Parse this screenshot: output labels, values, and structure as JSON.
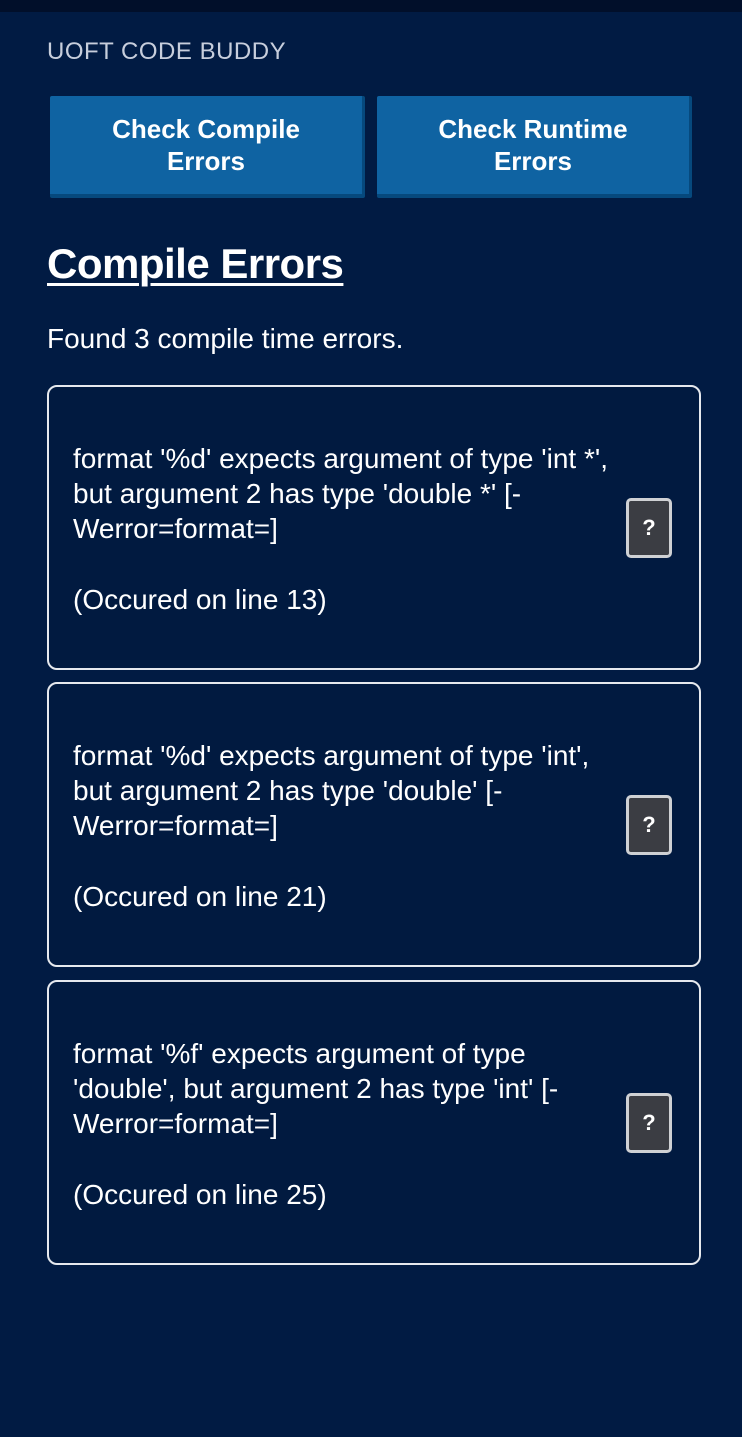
{
  "app": {
    "title": "UOFT CODE BUDDY"
  },
  "actions": {
    "compile_label": "Check Compile Errors",
    "runtime_label": "Check Runtime Errors"
  },
  "section": {
    "title": "Compile Errors",
    "summary": "Found 3 compile time errors."
  },
  "errors": [
    {
      "message": "format '%d' expects argument of type 'int *', but argument 2 has type 'double *' [-Werror=format=]",
      "line_text": "(Occured on line 13)",
      "help_label": "?"
    },
    {
      "message": "format '%d' expects argument of type 'int', but argument 2 has type 'double' [-Werror=format=]",
      "line_text": "(Occured on line 21)",
      "help_label": "?"
    },
    {
      "message": "format '%f' expects argument of type 'double', but argument 2 has type 'int' [-Werror=format=]",
      "line_text": "(Occured on line 25)",
      "help_label": "?"
    }
  ],
  "colors": {
    "background": "#011b43",
    "button": "#0f63a2",
    "help_button": "#3b3d43",
    "card_border": "#e6e9ee"
  }
}
